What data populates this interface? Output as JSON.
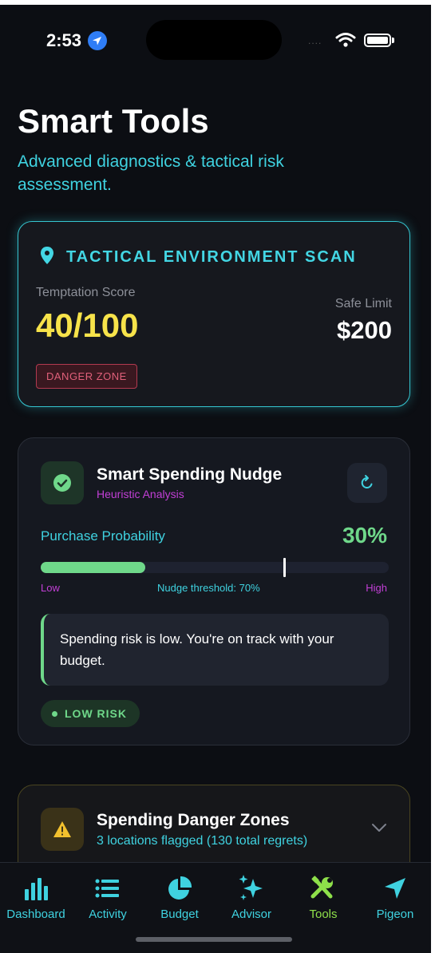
{
  "status_bar": {
    "time": "2:53",
    "signal": "...."
  },
  "header": {
    "title": "Smart Tools",
    "subtitle": "Advanced diagnostics & tactical risk assessment."
  },
  "scan_card": {
    "title": "TACTICAL ENVIRONMENT SCAN",
    "icon": "location-pin-icon",
    "temptation_label": "Temptation Score",
    "temptation_value": "40/100",
    "safe_limit_label": "Safe Limit",
    "safe_limit_value": "$200",
    "zone_badge": "DANGER ZONE"
  },
  "nudge_card": {
    "title": "Smart Spending Nudge",
    "subtitle": "Heuristic Analysis",
    "probability_label": "Purchase Probability",
    "probability_value": "30%",
    "probability_fraction": 0.3,
    "threshold_fraction": 0.7,
    "bar_low_label": "Low",
    "bar_threshold_label": "Nudge threshold: 70%",
    "bar_high_label": "High",
    "message": "Spending risk is low. You're on track with your budget.",
    "risk_badge": "LOW RISK"
  },
  "zones_card": {
    "title": "Spending Danger Zones",
    "subtitle": "3 locations flagged (130 total regrets)"
  },
  "tabs": [
    {
      "label": "Dashboard",
      "icon": "bar-chart-icon"
    },
    {
      "label": "Activity",
      "icon": "list-icon"
    },
    {
      "label": "Budget",
      "icon": "pie-chart-icon"
    },
    {
      "label": "Advisor",
      "icon": "sparkles-icon"
    },
    {
      "label": "Tools",
      "icon": "tools-icon",
      "active": true
    },
    {
      "label": "Pigeon",
      "icon": "navigation-arrow-icon"
    }
  ],
  "colors": {
    "accent_cyan": "#3fd2e0",
    "score_yellow": "#f7e34a",
    "success_green": "#6fd88a",
    "active_tab": "#8ee04a",
    "danger_red": "#e0607a",
    "magenta": "#c23fd6"
  }
}
